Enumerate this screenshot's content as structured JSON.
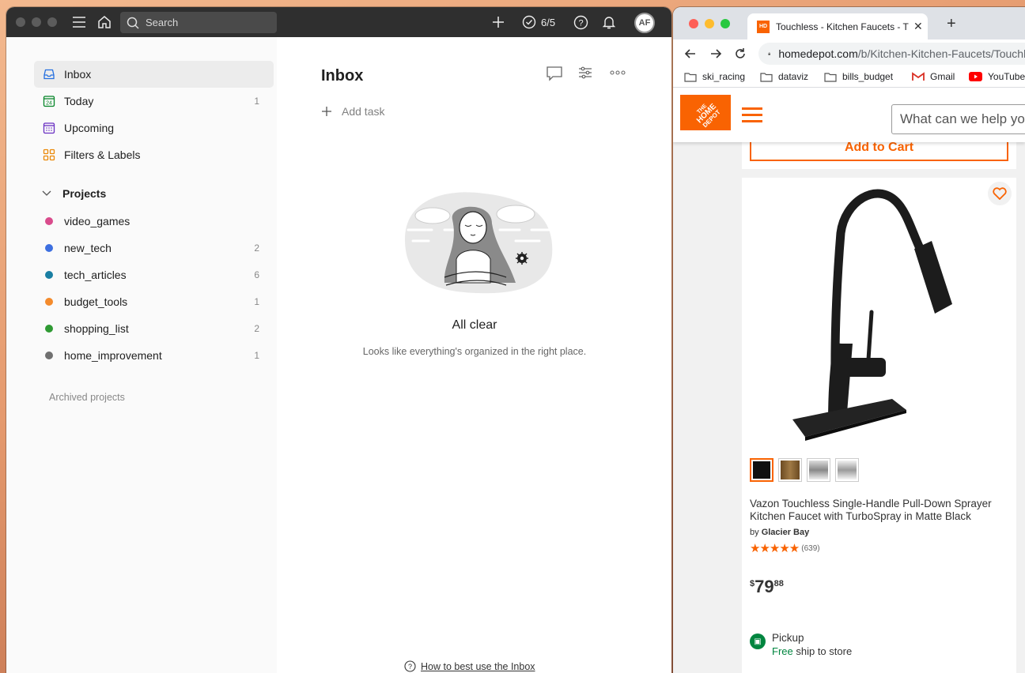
{
  "todoist": {
    "search_placeholder": "Search",
    "karma": "6/5",
    "avatar_initials": "AF",
    "sidebar": {
      "items": [
        {
          "label": "Inbox",
          "count": ""
        },
        {
          "label": "Today",
          "count": "1"
        },
        {
          "label": "Upcoming",
          "count": ""
        },
        {
          "label": "Filters & Labels",
          "count": ""
        }
      ],
      "projects_title": "Projects",
      "projects": [
        {
          "label": "video_games",
          "count": "",
          "color": "#d94b8c"
        },
        {
          "label": "new_tech",
          "count": "2",
          "color": "#3d6fe0"
        },
        {
          "label": "tech_articles",
          "count": "6",
          "color": "#1a7fa3"
        },
        {
          "label": "budget_tools",
          "count": "1",
          "color": "#f48b2c"
        },
        {
          "label": "shopping_list",
          "count": "2",
          "color": "#2f9a33"
        },
        {
          "label": "home_improvement",
          "count": "1",
          "color": "#707070"
        }
      ],
      "archived": "Archived projects"
    },
    "main": {
      "title": "Inbox",
      "add_task": "Add task",
      "empty_title": "All clear",
      "empty_subtitle": "Looks like everything's organized in the right place.",
      "help_link": "How to best use the Inbox"
    }
  },
  "chrome": {
    "tab_title": "Touchless - Kitchen Faucets - The Home Depot",
    "url_host": "homedepot.com",
    "url_path": "/b/Kitchen-Kitchen-Faucets/Touchless",
    "bookmarks": [
      "ski_racing",
      "dataviz",
      "bills_budget",
      "Gmail",
      "YouTube"
    ],
    "site": {
      "search_placeholder": "What can we help you find today?",
      "add_to_cart": "Add to Cart",
      "product": {
        "title": "Vazon Touchless Single-Handle Pull-Down Sprayer Kitchen Faucet with TurboSpray in Matte Black",
        "brand_prefix": "by",
        "brand": "Glacier Bay",
        "stars": "★★★★★",
        "rating_count": "(639)",
        "price_currency": "$",
        "price_dollars": "79",
        "price_cents": "88",
        "pickup_title": "Pickup",
        "pickup_free": "Free",
        "pickup_rest": "ship to store",
        "swatch_colors": [
          "#111111",
          "#7a5a2e",
          "#b8b8b8",
          "#d6d6d6"
        ]
      }
    }
  }
}
